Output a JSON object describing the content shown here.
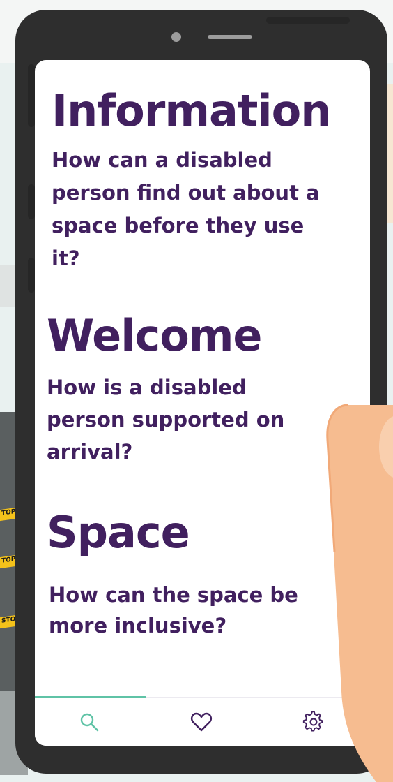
{
  "sections": [
    {
      "title": "Information",
      "question": "How can a disabled person find out about a space before they use it?"
    },
    {
      "title": "Welcome",
      "question": "How is a disabled person supported on arrival?"
    },
    {
      "title": "Space",
      "question": "How can the space be more inclusive?"
    }
  ],
  "bottom_nav": {
    "items": [
      {
        "icon": "search-icon",
        "active": true
      },
      {
        "icon": "heart-icon",
        "active": false
      },
      {
        "icon": "gear-icon",
        "active": false
      }
    ],
    "active_color": "#5fc3a6",
    "inactive_color": "#41205f"
  },
  "background": {
    "tape_labels": [
      "TOP",
      "TOP",
      "STOP"
    ]
  },
  "colors": {
    "accent": "#5fc3a6",
    "text": "#41205f",
    "phone_body": "#2e2e2e"
  }
}
